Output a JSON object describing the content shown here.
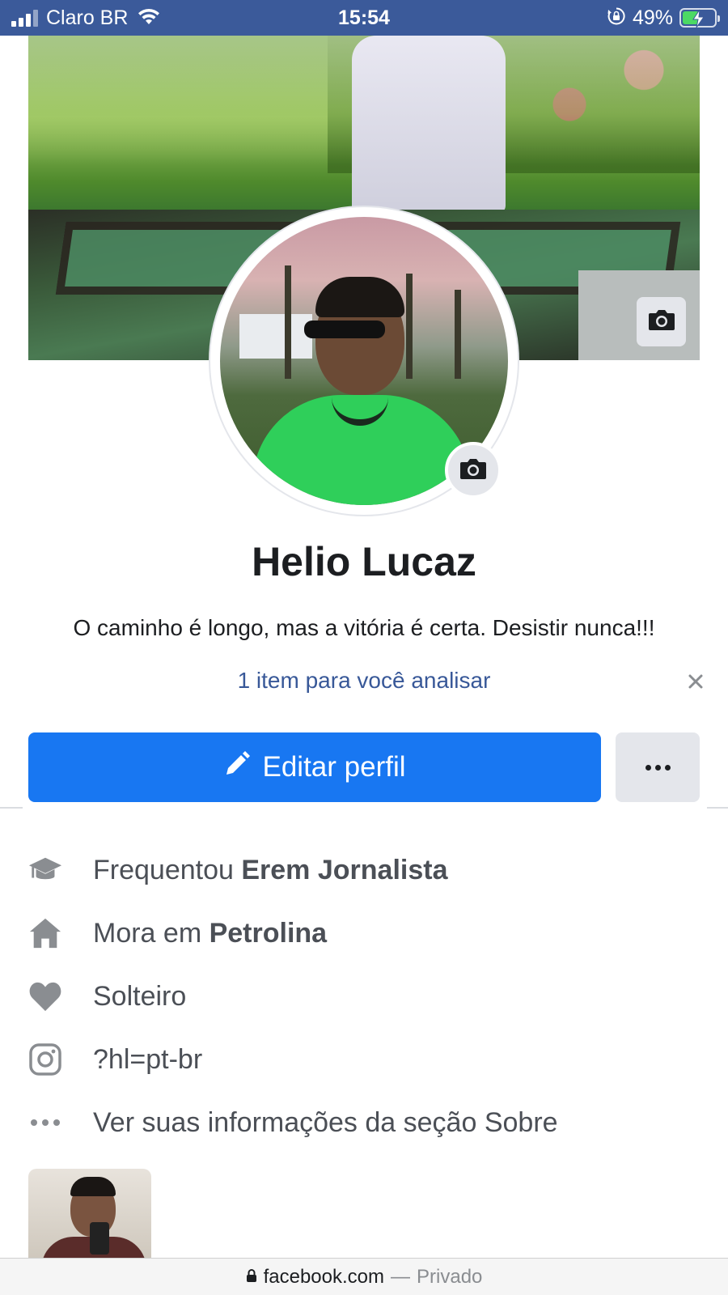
{
  "status_bar": {
    "carrier": "Claro BR",
    "time": "15:54",
    "battery_percent": "49%",
    "battery_level": 0.49,
    "icons": [
      "signal-icon",
      "wifi-icon",
      "orientation-lock-icon",
      "battery-charging-icon"
    ]
  },
  "profile": {
    "name": "Helio Lucaz",
    "bio": "O caminho é longo, mas a vitória é certa. Desistir nunca!!!",
    "review_link": "1 item para você analisar"
  },
  "actions": {
    "edit_label": "Editar perfil"
  },
  "info": [
    {
      "icon": "graduation-cap-icon",
      "prefix": "Frequentou ",
      "bold": "Erem Jornalista"
    },
    {
      "icon": "home-icon",
      "prefix": "Mora em ",
      "bold": "Petrolina"
    },
    {
      "icon": "heart-icon",
      "prefix": "Solteiro",
      "bold": ""
    },
    {
      "icon": "instagram-icon",
      "prefix": "?hl=pt-br",
      "bold": ""
    },
    {
      "icon": "more-dots-icon",
      "prefix": "Ver suas informações da seção Sobre",
      "bold": ""
    }
  ],
  "url_bar": {
    "domain": "facebook.com",
    "separator": "—",
    "privacy": "Privado"
  },
  "colors": {
    "status_bar": "#3b5a9a",
    "primary_button": "#1877f2",
    "link": "#385898",
    "icon_gray": "#8a8d91"
  }
}
